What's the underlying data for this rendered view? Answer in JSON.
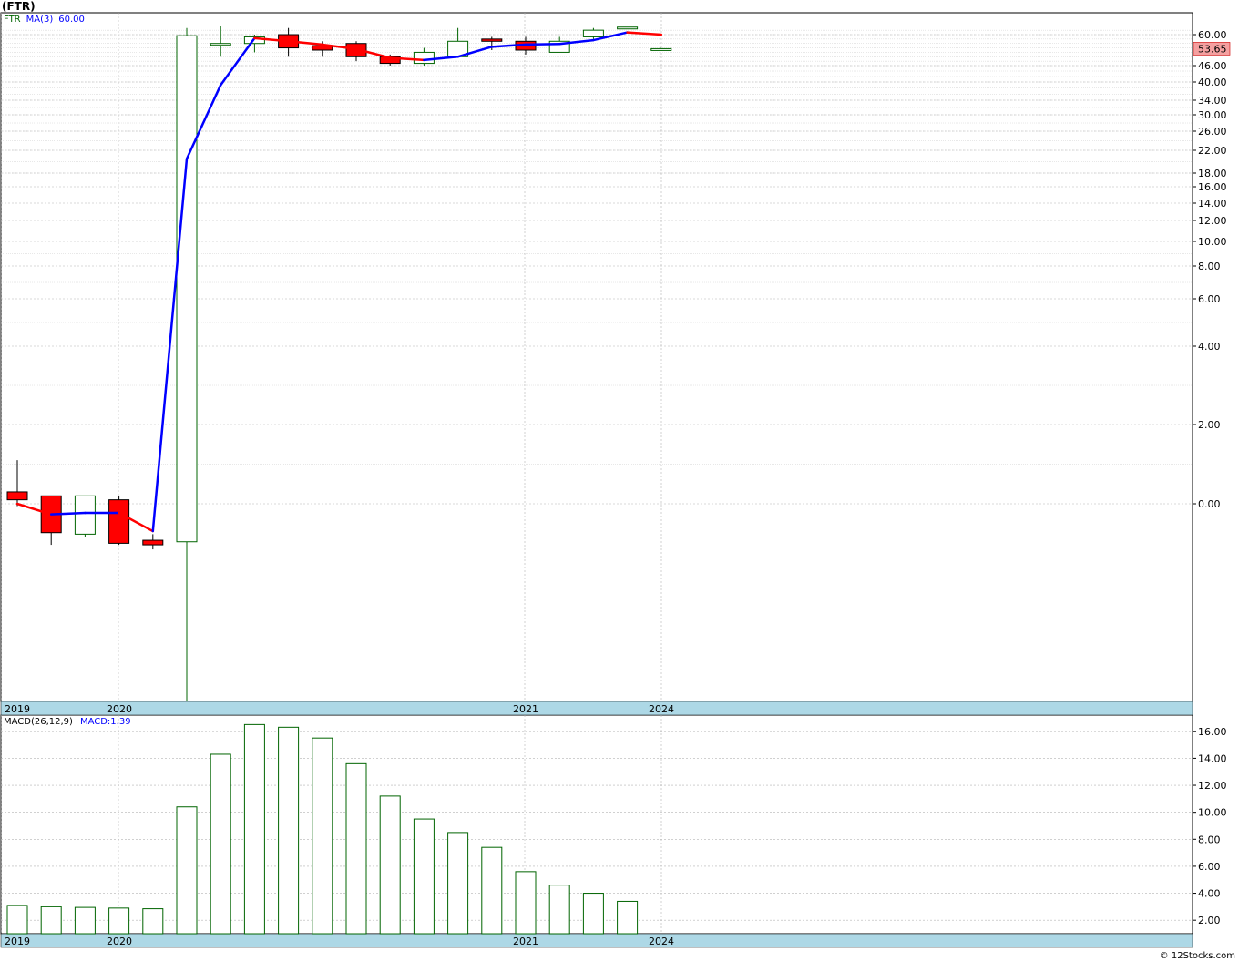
{
  "title": "(FTR)",
  "watermark": "© 12Stocks.com",
  "colors": {
    "up_candle_stroke": "#006400",
    "down_candle_fill": "#ff0000",
    "ma_up": "#0000ff",
    "ma_down": "#ff0000",
    "macd_bar": "#006400",
    "date_axis_bg": "#add8e6",
    "grid": "#b4b4b4",
    "last_price_bg": "#f4a0a0"
  },
  "chart_data": [
    {
      "type": "candlestick",
      "legend": {
        "symbol": "FTR",
        "ma_label": "MA(3)",
        "ma_value": "60.00"
      },
      "last_price_label": "53.65",
      "ytick_labels": [
        "60.00",
        "46.00",
        "40.00",
        "34.00",
        "30.00",
        "26.00",
        "22.00",
        "18.00",
        "16.00",
        "14.00",
        "12.00",
        "10.00",
        "8.00",
        "6.00",
        "4.00",
        "2.00",
        "0.00"
      ],
      "xtick_labels": [
        "2019",
        "2020",
        "2021",
        "2024"
      ],
      "candles": [
        {
          "open": 0.3,
          "high": 1.1,
          "low": -0.15,
          "close": 0.1
        },
        {
          "open": 0.2,
          "high": 0.1,
          "low": -2.7,
          "close": -1.9
        },
        {
          "open": -2.0,
          "high": 0.0,
          "low": -2.2,
          "close": 0.2
        },
        {
          "open": 0.1,
          "high": 0.2,
          "low": -2.7,
          "close": -2.6
        },
        {
          "open": -2.4,
          "high": -2.0,
          "low": -3.0,
          "close": -2.7
        },
        {
          "open": -2.5,
          "high": 63.0,
          "low": -13.0,
          "close": 59.5
        },
        {
          "open": 56.0,
          "high": 64.0,
          "low": 50.0,
          "close": 56.0
        },
        {
          "open": 56.0,
          "high": 60.0,
          "low": 52.0,
          "close": 59.0
        },
        {
          "open": 60.0,
          "high": 63.0,
          "low": 50.0,
          "close": 54.0
        },
        {
          "open": 55.0,
          "high": 57.0,
          "low": 50.0,
          "close": 53.0
        },
        {
          "open": 56.0,
          "high": 57.0,
          "low": 48.0,
          "close": 50.0
        },
        {
          "open": 50.0,
          "high": 51.0,
          "low": 46.0,
          "close": 47.0
        },
        {
          "open": 47.0,
          "high": 54.0,
          "low": 46.0,
          "close": 52.0
        },
        {
          "open": 50.0,
          "high": 63.0,
          "low": 50.0,
          "close": 57.0
        },
        {
          "open": 58.0,
          "high": 59.0,
          "low": 53.0,
          "close": 57.0
        },
        {
          "open": 57.0,
          "high": 59.0,
          "low": 51.0,
          "close": 53.0
        },
        {
          "open": 52.0,
          "high": 59.0,
          "low": 52.0,
          "close": 57.0
        },
        {
          "open": 59.0,
          "high": 63.0,
          "low": 58.0,
          "close": 62.0
        },
        {
          "open": 63.0,
          "high": 63.5,
          "low": 63.0,
          "close": 63.4
        },
        {
          "open": 53.65,
          "high": 54.0,
          "low": 53.3,
          "close": 53.65
        }
      ],
      "ma3": [
        0.0,
        -0.7,
        -0.6,
        -0.6,
        -1.8,
        20.5,
        39.0,
        58.4,
        57.0,
        55.5,
        53.5,
        49.5,
        48.5,
        50.0,
        54.5,
        55.5,
        55.8,
        57.5,
        61.0,
        60.0
      ]
    },
    {
      "type": "bar",
      "legend": {
        "name": "MACD(26,12,9)",
        "value_label": "MACD:1.39"
      },
      "ytick_labels": [
        "16.00",
        "14.00",
        "12.00",
        "10.00",
        "8.00",
        "6.00",
        "4.00",
        "2.00"
      ],
      "xtick_labels": [
        "2019",
        "2020",
        "2021",
        "2024"
      ],
      "values": [
        3.1,
        3.0,
        2.95,
        2.9,
        2.85,
        10.4,
        14.3,
        16.5,
        16.3,
        15.5,
        13.6,
        11.2,
        9.5,
        8.5,
        7.4,
        5.6,
        4.6,
        4.0,
        3.4
      ],
      "ylim": [
        1.0,
        17.2
      ]
    }
  ]
}
